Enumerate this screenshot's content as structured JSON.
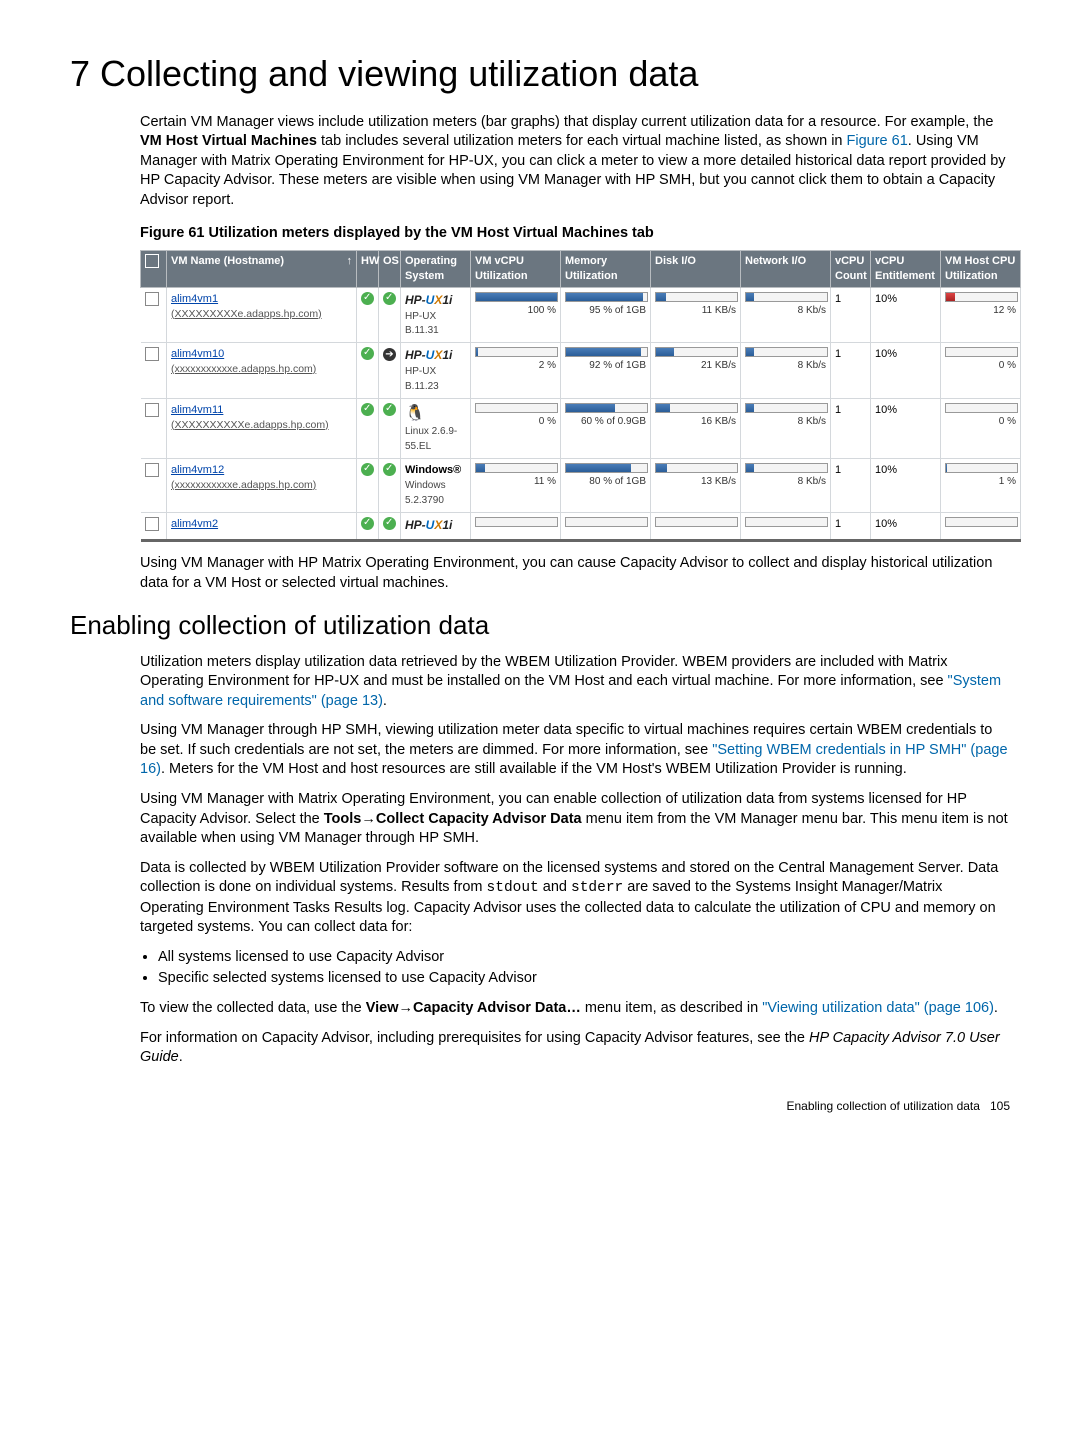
{
  "page": {
    "title": "7 Collecting and viewing utilization data",
    "intro": "Certain VM Manager views include utilization meters (bar graphs) that display current utilization data for a resource. For example, the ",
    "intro_bold1": "VM Host Virtual Machines",
    "intro_mid": " tab includes several utilization meters for each virtual machine listed, as shown in ",
    "intro_link1": "Figure 61",
    "intro_tail": ". Using VM Manager with Matrix Operating Environment for HP-UX, you can click a meter to view a more detailed historical data report provided by HP Capacity Advisor. These meters are visible when using VM Manager with HP SMH, but you cannot click them to obtain a Capacity Advisor report.",
    "fig_caption": "Figure 61 Utilization meters displayed by the VM Host Virtual Machines tab",
    "after_fig": "Using VM Manager with HP Matrix Operating Environment, you can cause Capacity Advisor to collect and display historical utilization data for a VM Host or selected virtual machines.",
    "h2": "Enabling collection of utilization data",
    "p2a": "Utilization meters display utilization data retrieved by the WBEM Utilization Provider. WBEM providers are included with Matrix Operating Environment for HP-UX and must be installed on the VM Host and each virtual machine. For more information, see ",
    "p2a_link": "\"System and software requirements\" (page 13)",
    "p2a_end": ".",
    "p2b_a": "Using VM Manager through HP SMH, viewing utilization meter data specific to virtual machines requires certain WBEM credentials to be set. If such credentials are not set, the meters are dimmed. For more information, see ",
    "p2b_link": "\"Setting WBEM credentials in HP SMH\" (page 16)",
    "p2b_b": ". Meters for the VM Host and host resources are still available if the VM Host's WBEM Utilization Provider is running.",
    "p3a": "Using VM Manager with Matrix Operating Environment, you can enable collection of utilization data from systems licensed for HP Capacity Advisor. Select the ",
    "p3_b1": "Tools",
    "p3_b2": "Collect Capacity Advisor Data",
    "p3b": " menu item from the VM Manager menu bar. This menu item is not available when using VM Manager through HP SMH.",
    "p4a": "Data is collected by WBEM Utilization Provider software on the licensed systems and stored on the Central Management Server. Data collection is done on individual systems. Results from ",
    "p4_m1": "stdout",
    "p4b": " and ",
    "p4_m2": "stderr",
    "p4c": " are saved to the Systems Insight Manager/Matrix Operating Environment Tasks Results log. Capacity Advisor uses the collected data to calculate the utilization of CPU and memory on targeted systems. You can collect data for:",
    "li1": "All systems licensed to use Capacity Advisor",
    "li2": "Specific selected systems licensed to use Capacity Advisor",
    "p5a": "To view the collected data, use the ",
    "p5_b1": "View",
    "p5_b2": "Capacity Advisor Data…",
    "p5b": " menu item, as described in ",
    "p5_link": "\"Viewing utilization data\" (page 106)",
    "p5c": ".",
    "p6a": "For information on Capacity Advisor, including prerequisites for using Capacity Advisor features, see the ",
    "p6_i": "HP Capacity Advisor 7.0 User Guide",
    "p6b": ".",
    "footer_text": "Enabling collection of utilization data",
    "footer_page": "105"
  },
  "table": {
    "headers": {
      "name": "VM Name (Hostname)",
      "hw": "HW",
      "os": "OS",
      "opsys": "Operating System",
      "vcpu": "VM vCPU Utilization",
      "mem": "Memory Utilization",
      "disk": "Disk I/O",
      "net": "Network I/O",
      "count": "vCPU Count",
      "ent": "vCPU Entitlement",
      "host": "VM Host CPU Utilization"
    },
    "rows": [
      {
        "name": "alim4vm1",
        "sub": "(XXXXXXXXXe.adapps.hp.com)",
        "hw": "check",
        "os": "check",
        "opsys_main": "HP-UX",
        "opsys_sub": "HP-UX B.11.31",
        "vcpu_pct": 100,
        "vcpu_label": "100 %",
        "mem_pct": 95,
        "mem_label": "95 % of 1GB",
        "disk_pct": 12,
        "disk_label": "11 KB/s",
        "net_pct": 10,
        "net_label": "8 Kb/s",
        "count": "1",
        "ent": "10%",
        "host_pct": 12,
        "host_label": "12 %",
        "host_red": true
      },
      {
        "name": "alim4vm10",
        "sub": "(xxxxxxxxxxxe.adapps.hp.com)",
        "hw": "check",
        "os": "arrow",
        "opsys_main": "HP-UX",
        "opsys_sub": "HP-UX B.11.23",
        "vcpu_pct": 2,
        "vcpu_label": "2 %",
        "mem_pct": 92,
        "mem_label": "92 % of 1GB",
        "disk_pct": 22,
        "disk_label": "21 KB/s",
        "net_pct": 10,
        "net_label": "8 Kb/s",
        "count": "1",
        "ent": "10%",
        "host_pct": 0,
        "host_label": "0 %"
      },
      {
        "name": "alim4vm11",
        "sub": "(XXXXXXXXXXe.adapps.hp.com)",
        "hw": "check",
        "os": "check",
        "opsys_main": "linux",
        "opsys_sub": "Linux 2.6.9-55.EL",
        "vcpu_pct": 0,
        "vcpu_label": "0 %",
        "mem_pct": 60,
        "mem_label": "60 % of 0.9GB",
        "disk_pct": 17,
        "disk_label": "16 KB/s",
        "net_pct": 10,
        "net_label": "8 Kb/s",
        "count": "1",
        "ent": "10%",
        "host_pct": 0,
        "host_label": "0 %"
      },
      {
        "name": "alim4vm12",
        "sub": "(xxxxxxxxxxxe.adapps.hp.com)",
        "hw": "check",
        "os": "check",
        "opsys_main": "windows",
        "opsys_sub": "Windows 5.2.3790",
        "vcpu_pct": 11,
        "vcpu_label": "11 %",
        "mem_pct": 80,
        "mem_label": "80 % of 1GB",
        "disk_pct": 14,
        "disk_label": "13 KB/s",
        "net_pct": 10,
        "net_label": "8 Kb/s",
        "count": "1",
        "ent": "10%",
        "host_pct": 1,
        "host_label": "1 %"
      },
      {
        "name": "alim4vm2",
        "sub": "",
        "hw": "check",
        "os": "check",
        "opsys_main": "HP-UX",
        "opsys_sub": "",
        "vcpu_pct": 0,
        "vcpu_label": "",
        "mem_pct": 0,
        "mem_label": "",
        "disk_pct": 0,
        "disk_label": "",
        "net_pct": 0,
        "net_label": "",
        "count": "1",
        "ent": "10%",
        "host_pct": 0,
        "host_label": ""
      }
    ]
  }
}
